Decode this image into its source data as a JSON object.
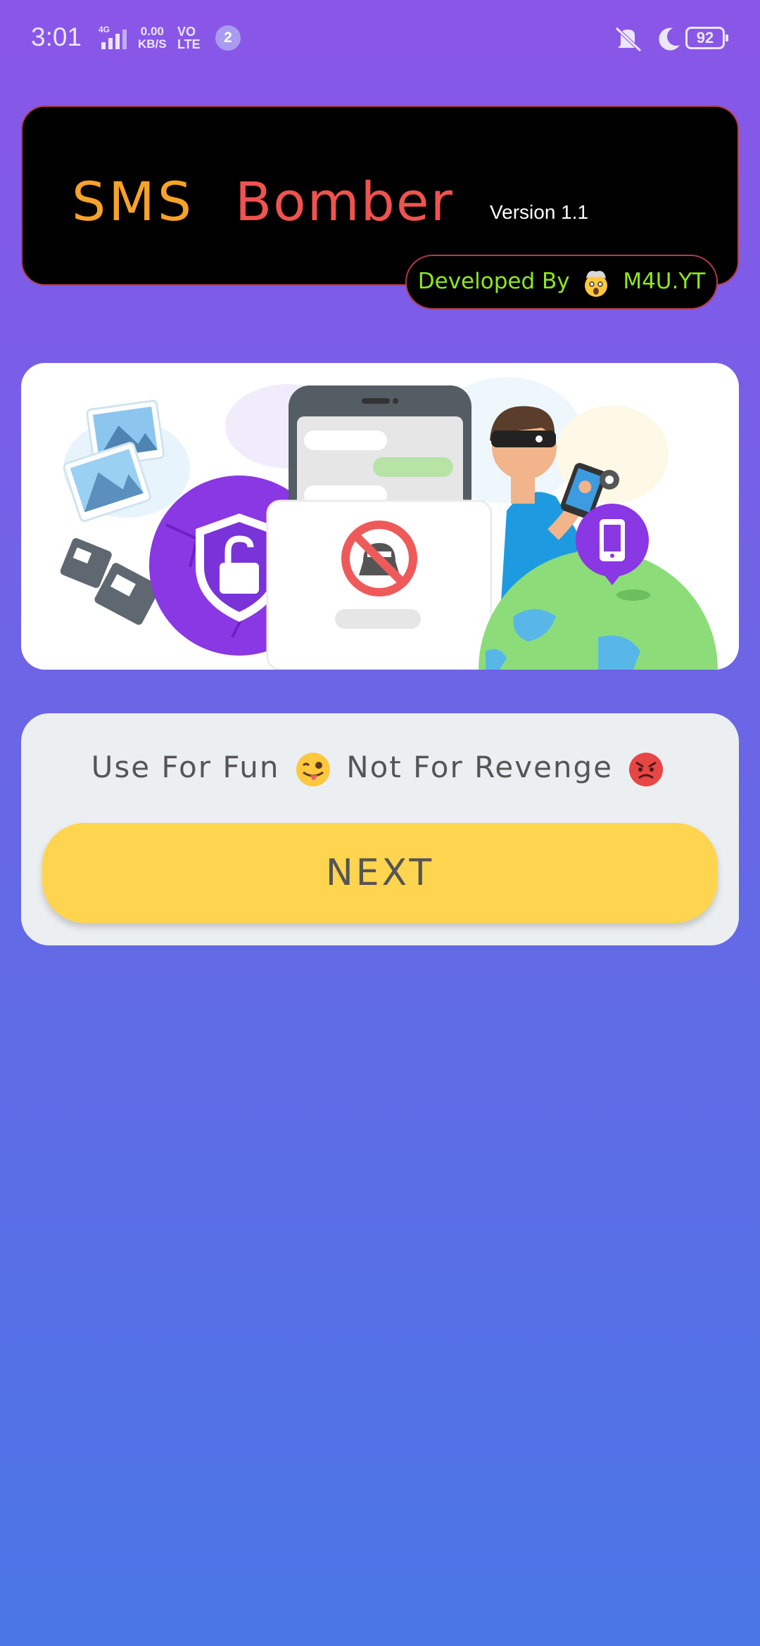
{
  "status_bar": {
    "time": "3:01",
    "network_type": "4G",
    "speed_value": "0.00",
    "speed_unit": "KB/S",
    "volte_top": "VO",
    "volte_bottom": "LTE",
    "notification_count": "2",
    "battery_level": "92"
  },
  "header": {
    "title_part1": "SMS",
    "title_part2": "Bomber",
    "version": "Version 1.1",
    "developer_prefix": "Developed By",
    "developer_name": "M4U.YT",
    "colors": {
      "sms": "#f7a22a",
      "bomber": "#ef5350",
      "developer": "#8fe81a"
    }
  },
  "illustration": {
    "icons": [
      "photos-icon",
      "broken-shield-lock-icon",
      "phone-chat-icon",
      "no-spy-icon",
      "masked-hacker-icon",
      "globe-icon",
      "phone-pin-icon"
    ]
  },
  "bottom": {
    "tagline_part1": "Use For Fun",
    "tagline_part2": "Not For Revenge",
    "next_label": "NEXT",
    "button_color": "#ffd54f"
  }
}
